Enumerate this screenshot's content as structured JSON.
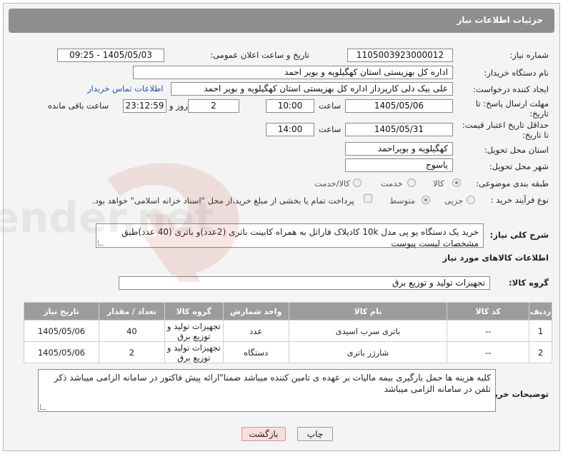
{
  "header": {
    "title": "جزئیات اطلاعات نیاز"
  },
  "fields": {
    "need_number_label": "شماره نیاز:",
    "need_number_value": "1105003923000012",
    "announce_label": "تاریخ و ساعت اعلان عمومی:",
    "announce_value": "1405/05/03 - 09:25",
    "buyer_org_label": "نام دستگاه خریدار:",
    "buyer_org_value": "اداره کل بهزیستی استان کهگیلویه و بویر احمد",
    "requester_label": "ایجاد کننده درخواست:",
    "requester_value": "علی بیک دلی کارپرداز اداره کل بهزیستی استان کهگیلویه و بویر احمد",
    "contact_link": "اطلاعات تماس خریدار",
    "deadline_label_1": "مهلت ارسال پاسخ: تا",
    "deadline_label_2": "تاریخ:",
    "deadline_date": "1405/05/06",
    "time_label": "ساعت",
    "deadline_time": "10:00",
    "days_value": "2",
    "days_label": "روز و",
    "remaining_value": "23:12:59",
    "remaining_label": "ساعت باقی مانده",
    "validity_label_1": "حداقل تاریخ اعتبار قیمت:",
    "validity_label_2": "تا تاریخ:",
    "validity_date": "1405/05/31",
    "validity_time": "14:00",
    "province_label": "استان محل تحویل:",
    "province_value": "کهگیلویه و بویراحمد",
    "city_label": "شهر محل تحویل:",
    "city_value": "یاسوج",
    "category_label": "طبقه بندی موضوعی:",
    "category_options": [
      "کالا",
      "خدمت",
      "کالا/خدمت"
    ],
    "process_label": "نوع فرآیند خرید :",
    "process_options": [
      "جزیی",
      "متوسط"
    ],
    "payment_note": "پرداخت تمام یا بخشی از مبلغ خرید،از محل \"اسناد خزانه اسلامی\" خواهد بود."
  },
  "description": {
    "label": "شرح کلی نیاز:",
    "text": "خرید یک دستگاه یو پی مدل 10k کادیلاک فاراتل به همراه کابینت باتری (2عدد)و باتری (40 عدد)طبق مشخصات لیست پیوست"
  },
  "goods": {
    "section_title": "اطلاعات کالاهای مورد نیاز",
    "group_label": "گروه کالا:",
    "group_value": "تجهیزات تولید و توزیع برق",
    "columns": [
      "ردیف",
      "کد کالا",
      "نام کالا",
      "واحد شمارش",
      "گروه کالا",
      "تعداد / مقدار",
      "تاریخ نیاز"
    ],
    "rows": [
      {
        "row": "1",
        "code": "--",
        "name": "باتری سرب اسیدی",
        "unit": "عدد",
        "group": "تجهیزات تولید و توزیع برق",
        "qty": "40",
        "date": "1405/05/06"
      },
      {
        "row": "2",
        "code": "--",
        "name": "شارژر باتری",
        "unit": "دستگاه",
        "group": "تجهیزات تولید و توزیع برق",
        "qty": "2",
        "date": "1405/05/06"
      }
    ]
  },
  "buyer_notes": {
    "label": "توضیحات خریدار:",
    "text": "کلیه هزینه ها حمل بارگیری بیمه مالیات بر عهده ی تامین کننده میباشد ضمنا\"ارائه پیش فاکتور در سامانه الزامی میباشد ذکر تلفن در سامانه الزامی میباشد"
  },
  "buttons": {
    "print": "چاپ",
    "back": "بازگشت"
  },
  "watermark": "AriaTender.net"
}
